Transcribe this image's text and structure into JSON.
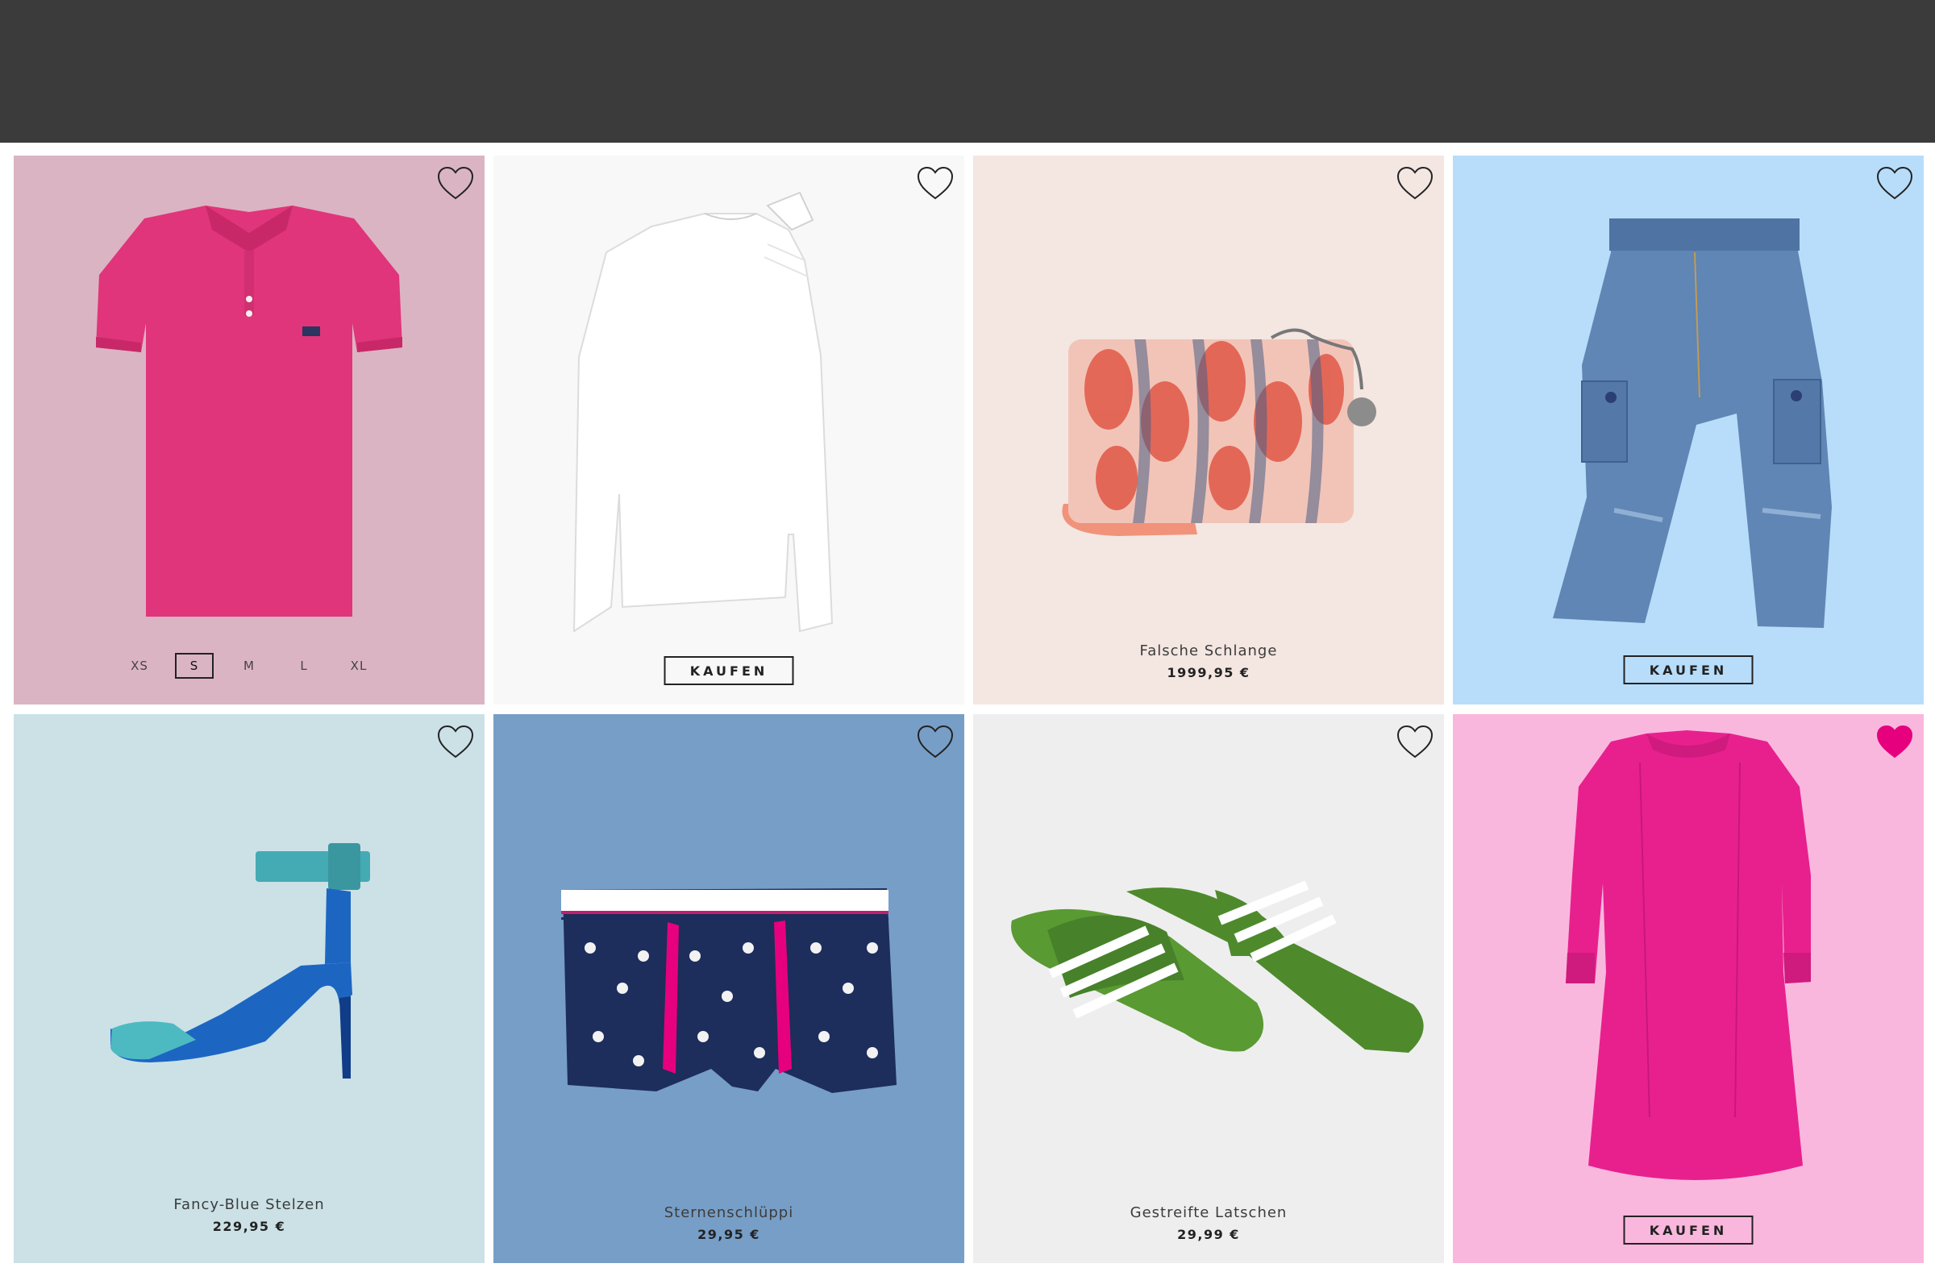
{
  "products": [
    {
      "bg": "#dbb4c3",
      "favorite": false,
      "sizes": [
        "XS",
        "S",
        "M",
        "L",
        "XL"
      ],
      "selected_size": "S"
    },
    {
      "bg": "#f8f8f8",
      "favorite": false,
      "buy_label": "KAUFEN"
    },
    {
      "bg": "#f4e6e1",
      "favorite": false,
      "name": "Falsche Schlange",
      "price": "1999,95 €"
    },
    {
      "bg": "#b8ddfa",
      "favorite": false,
      "buy_label": "KAUFEN"
    },
    {
      "bg": "#cbe1e6",
      "favorite": false,
      "name": "Fancy-Blue Stelzen",
      "price": "229,95 €"
    },
    {
      "bg": "#779ec6",
      "favorite": false,
      "name": "Sternenschlüppi",
      "price": "29,95 €"
    },
    {
      "bg": "#eeeeee",
      "favorite": false,
      "name": "Gestreifte Latschen",
      "price": "29,99 €"
    },
    {
      "bg": "#fab7dd",
      "favorite": true,
      "buy_label": "KAUFEN"
    }
  ],
  "colors": {
    "topbar": "#3b3b3b",
    "heart_active": "#e6007e"
  }
}
